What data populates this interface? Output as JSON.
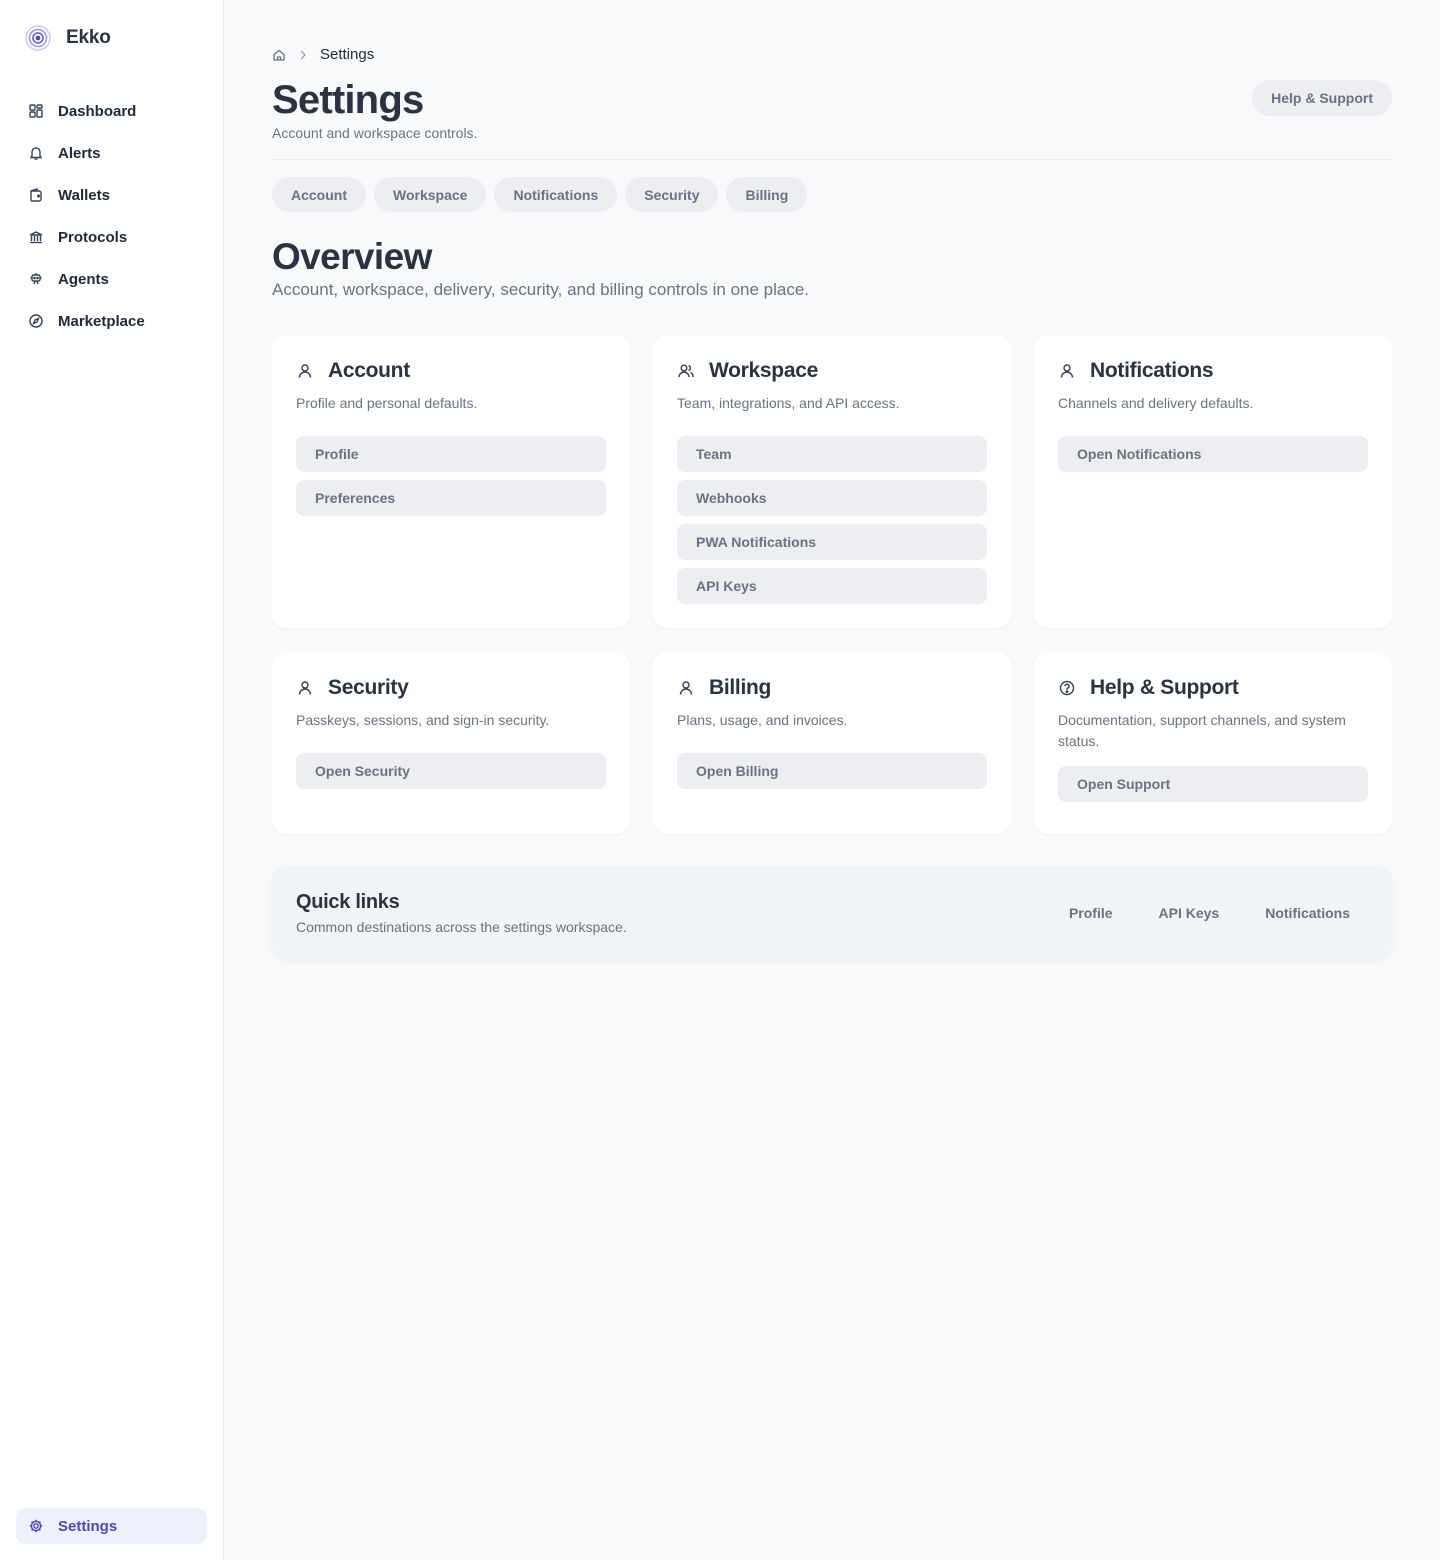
{
  "brand": {
    "name": "Ekko",
    "accent": "#5b5bd6"
  },
  "sidebar": {
    "items": [
      {
        "label": "Dashboard",
        "icon": "dashboard-icon"
      },
      {
        "label": "Alerts",
        "icon": "bell-icon"
      },
      {
        "label": "Wallets",
        "icon": "wallet-icon"
      },
      {
        "label": "Protocols",
        "icon": "bank-icon"
      },
      {
        "label": "Agents",
        "icon": "robot-icon"
      },
      {
        "label": "Marketplace",
        "icon": "compass-icon"
      }
    ],
    "settings": {
      "label": "Settings",
      "icon": "gear-icon"
    }
  },
  "breadcrumb": {
    "home_icon": "home-icon",
    "current": "Settings"
  },
  "header": {
    "title": "Settings",
    "subtitle": "Account and workspace controls.",
    "help_label": "Help & Support"
  },
  "tabs": [
    "Account",
    "Workspace",
    "Notifications",
    "Security",
    "Billing"
  ],
  "overview": {
    "title": "Overview",
    "subtitle": "Account, workspace, delivery, security, and billing controls in one place."
  },
  "cards": [
    {
      "title": "Account",
      "icon": "user-icon",
      "desc": "Profile and personal defaults.",
      "links": [
        "Profile",
        "Preferences"
      ]
    },
    {
      "title": "Workspace",
      "icon": "users-icon",
      "desc": "Team, integrations, and API access.",
      "links": [
        "Team",
        "Webhooks",
        "PWA Notifications",
        "API Keys"
      ]
    },
    {
      "title": "Notifications",
      "icon": "user-icon",
      "desc": "Channels and delivery defaults.",
      "links": [
        "Open Notifications"
      ]
    },
    {
      "title": "Security",
      "icon": "user-icon",
      "desc": "Passkeys, sessions, and sign-in security.",
      "links": [
        "Open Security"
      ]
    },
    {
      "title": "Billing",
      "icon": "user-icon",
      "desc": "Plans, usage, and invoices.",
      "links": [
        "Open Billing"
      ]
    },
    {
      "title": "Help & Support",
      "icon": "help-circle-icon",
      "desc": "Documentation, support channels, and system status.",
      "links": [
        "Open Support"
      ]
    }
  ],
  "quick_links": {
    "title": "Quick links",
    "subtitle": "Common destinations across the settings workspace.",
    "links": [
      "Profile",
      "API Keys",
      "Notifications"
    ]
  }
}
